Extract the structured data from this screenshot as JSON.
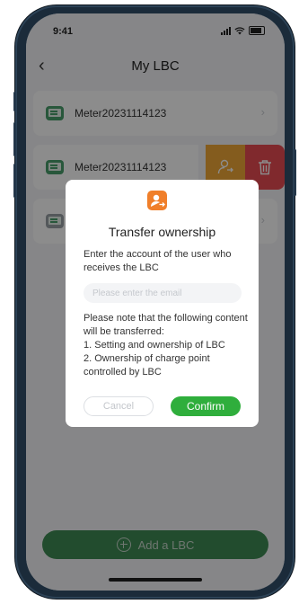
{
  "status": {
    "time": "9:41"
  },
  "nav": {
    "title": "My LBC"
  },
  "meters": [
    {
      "name": "Meter20231114123"
    },
    {
      "name": "Meter20231114123"
    }
  ],
  "bottom": {
    "add_label": "Add a LBC"
  },
  "dialog": {
    "title": "Transfer ownership",
    "description": "Enter the account of the user who receives the LBC",
    "email_placeholder": "Please enter the email",
    "email_value": "",
    "note_heading": "Please note that the following content will be transferred:",
    "note_items": [
      "1. Setting and ownership of LBC",
      "2. Ownership of charge point controlled by LBC"
    ],
    "cancel_label": "Cancel",
    "confirm_label": "Confirm"
  },
  "colors": {
    "accent_green": "#2fae3c",
    "transfer_orange": "#f0a838",
    "delete_red": "#ea4b53",
    "dialog_icon_orange": "#f07f2a"
  },
  "icons": {
    "back": "chevron-left-icon",
    "meter": "meter-icon",
    "transfer": "transfer-user-icon",
    "delete": "trash-icon",
    "add": "plus-circle-icon",
    "dialog": "transfer-ownership-icon"
  }
}
